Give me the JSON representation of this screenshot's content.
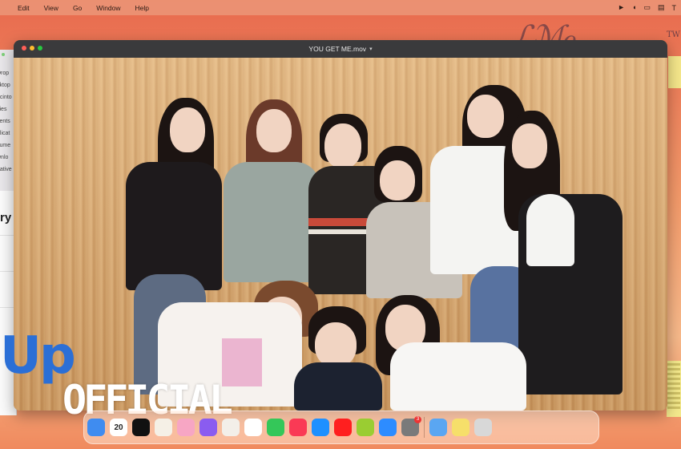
{
  "menubar": {
    "items": [
      "Edit",
      "View",
      "Go",
      "Window",
      "Help"
    ],
    "right_text": "T"
  },
  "finder": {
    "items": [
      "Drop",
      "sktop",
      "acinto",
      "vies",
      "cents",
      "plicat",
      "cume",
      "wnlo",
      "eative"
    ]
  },
  "notes": {
    "partial_title": "ry"
  },
  "player": {
    "title": "YOU GET ME.mov",
    "traffic_lights": [
      "#ff5f57",
      "#febc2e",
      "#28c840"
    ]
  },
  "watermark": {
    "line1": "Up",
    "line2": "OFFICIAL"
  },
  "dock": {
    "apps": [
      {
        "name": "finder-icon",
        "color": "#3f8cf0"
      },
      {
        "name": "calendar-icon",
        "color": "#ffffff",
        "label": "20"
      },
      {
        "name": "capcut-icon",
        "color": "#111111"
      },
      {
        "name": "notes-icon",
        "color": "#f5f0e6"
      },
      {
        "name": "photos-icon",
        "color": "#f7a6c4"
      },
      {
        "name": "siri-icon",
        "color": "#8a5cf0"
      },
      {
        "name": "freeform-icon",
        "color": "#f3efe9"
      },
      {
        "name": "weverse-icon",
        "color": "#ffffff"
      },
      {
        "name": "facetime-icon",
        "color": "#34c759"
      },
      {
        "name": "music-icon",
        "color": "#fa3a55"
      },
      {
        "name": "safari-icon",
        "color": "#1e90ff"
      },
      {
        "name": "youtube-icon",
        "color": "#ff1f1f"
      },
      {
        "name": "chrome-icon",
        "color": "#9acd32"
      },
      {
        "name": "app-store-icon",
        "color": "#2d8cff"
      },
      {
        "name": "system-settings-icon",
        "color": "#7a7a7a",
        "badge": "3"
      },
      {
        "name": "folder-icon",
        "color": "#5aa6f2"
      },
      {
        "name": "notes-stack-icon",
        "color": "#f6df6a"
      },
      {
        "name": "trash-icon",
        "color": "#d8d8d8"
      }
    ]
  }
}
